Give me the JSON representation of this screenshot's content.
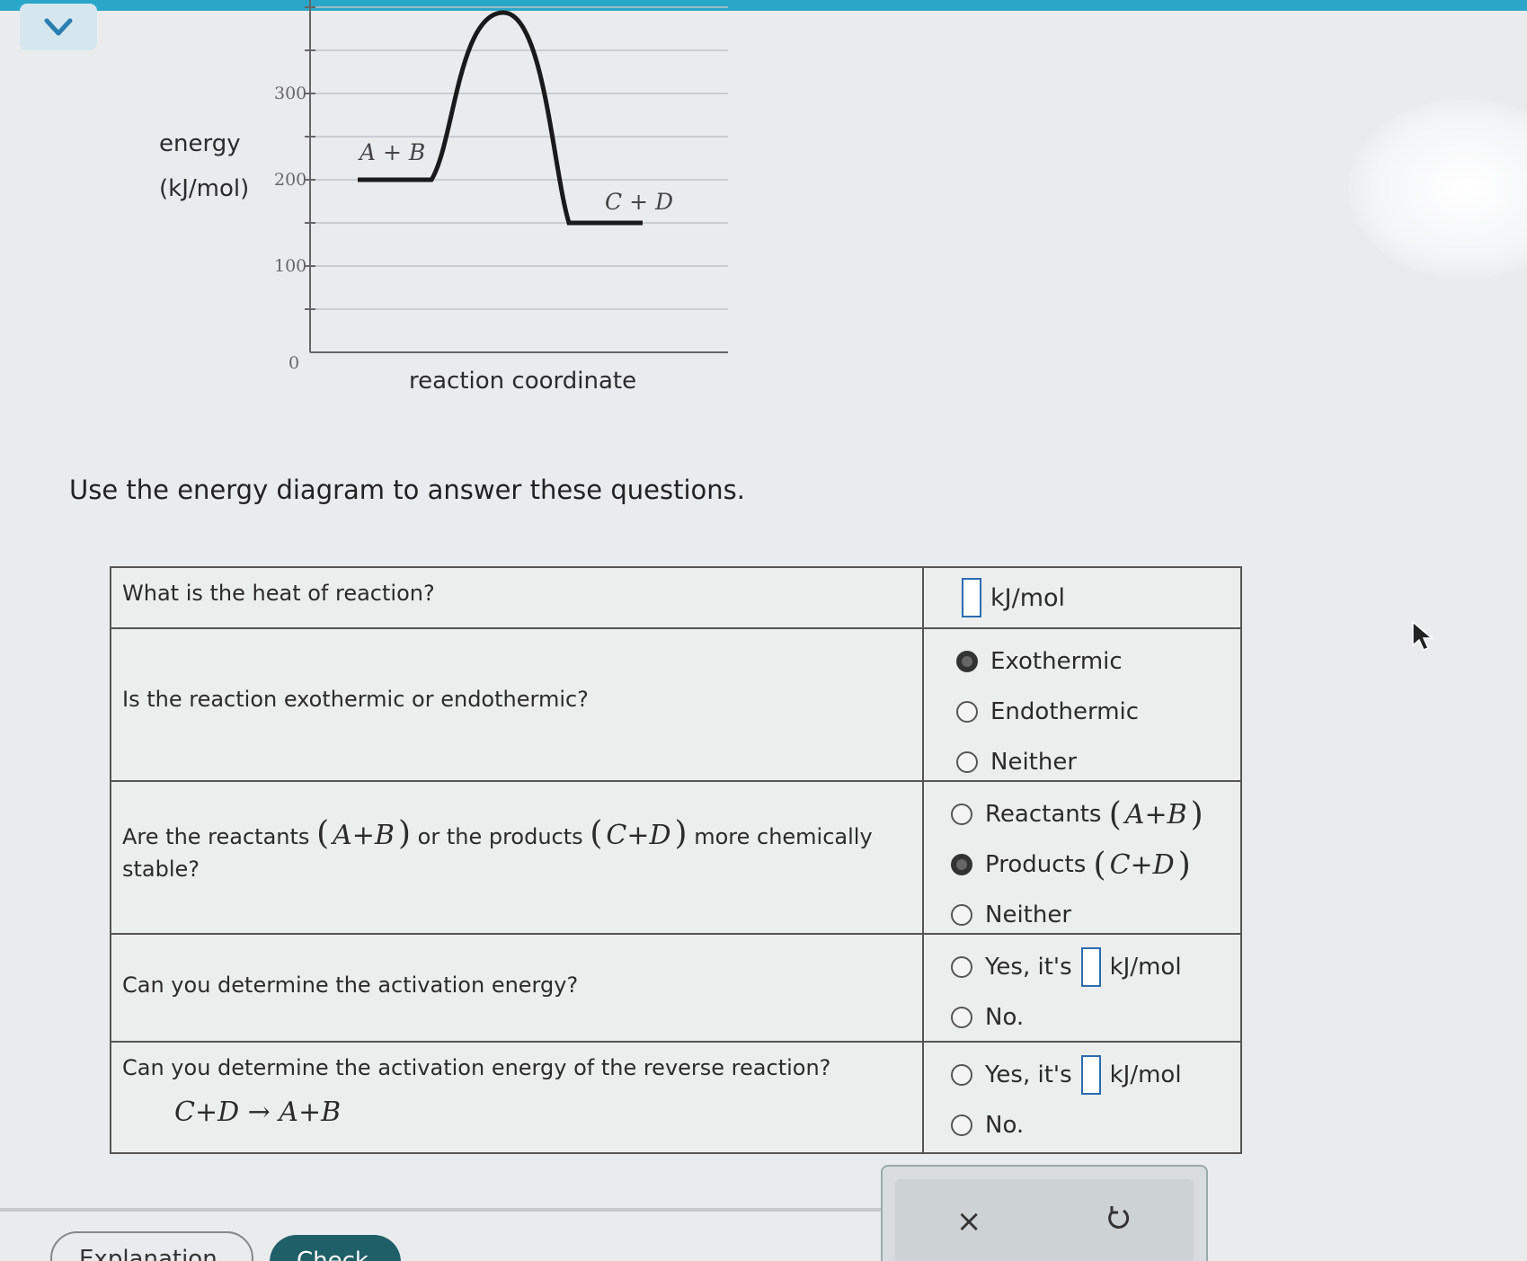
{
  "header": {
    "collapse_icon": "chevron-down-icon"
  },
  "chart_data": {
    "type": "line",
    "ylabel_line1": "energy",
    "ylabel_line2": "(kJ/mol)",
    "xlabel": "reaction coordinate",
    "y_ticks": [
      "0",
      "100",
      "200",
      "300"
    ],
    "ylim": [
      0,
      400
    ],
    "reactants_label": "A  +  B",
    "products_label": "C  +  D",
    "reactants_energy": 200,
    "transition_energy": 400,
    "products_energy": 150
  },
  "instruction": "Use the energy diagram to answer these questions.",
  "questions": {
    "q1": {
      "text": "What is the heat of reaction?",
      "unit": "kJ/mol"
    },
    "q2": {
      "text": "Is the reaction exothermic or endothermic?",
      "options": [
        "Exothermic",
        "Endothermic",
        "Neither"
      ],
      "selected": "Exothermic"
    },
    "q3": {
      "text_pre": "Are the reactants",
      "reactants": "A+B",
      "text_mid": "or the products",
      "products": "C+D",
      "text_post": "more chemically stable?",
      "opt_reactants": "Reactants",
      "opt_products": "Products",
      "opt_neither": "Neither",
      "selected": "Products"
    },
    "q4": {
      "text": "Can you determine the activation energy?",
      "yes_pre": "Yes,  it's",
      "unit": "kJ/mol",
      "no": "No."
    },
    "q5": {
      "text": "Can you determine the activation energy of the reverse reaction?",
      "equation": "C+D → A+B",
      "yes_pre": "Yes,  it's",
      "unit": "kJ/mol",
      "no": "No."
    }
  },
  "actions": {
    "clear": "×",
    "undo_icon": "undo-icon"
  },
  "buttons": {
    "explanation": "Explanation",
    "check": "Check"
  }
}
